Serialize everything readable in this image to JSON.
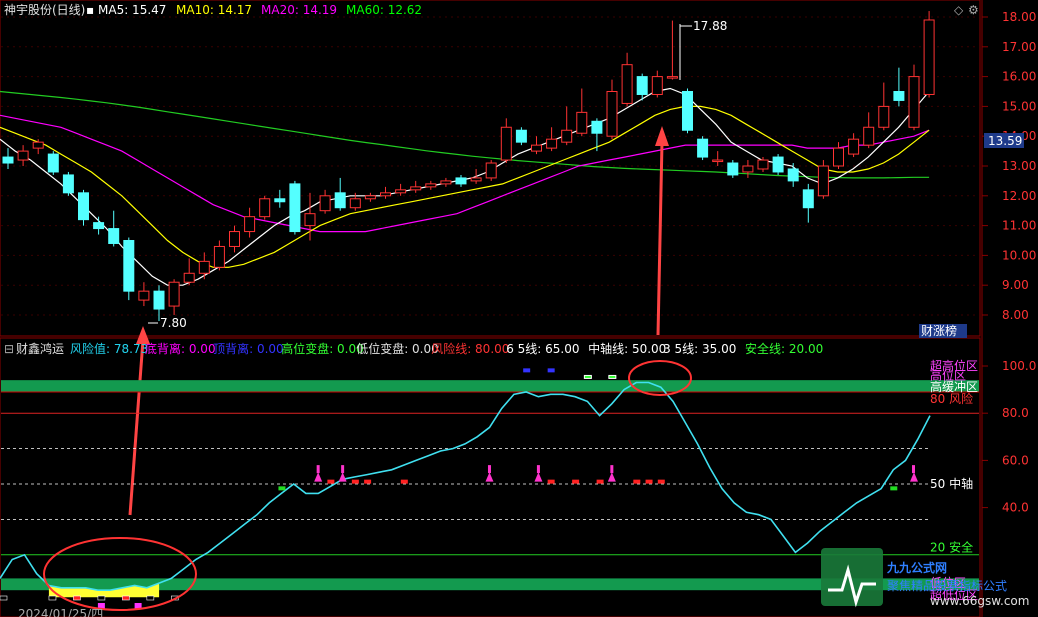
{
  "main_panel": {
    "title": "神宇股份(日线)",
    "ma_labels": [
      {
        "text": "MA5: 15.47",
        "color": "#ffffff"
      },
      {
        "text": "MA10: 14.17",
        "color": "#ffff00"
      },
      {
        "text": "MA20: 14.19",
        "color": "#ff00ff"
      },
      {
        "text": "MA60: 12.62",
        "color": "#00ff00"
      }
    ],
    "price_axis": [
      "18.00",
      "17.00",
      "16.00",
      "15.00",
      "14.00",
      "13.00",
      "12.00",
      "11.00",
      "10.00",
      "9.00",
      "8.00"
    ],
    "price_min": 7.5,
    "price_max": 18.2,
    "current_price": "13.59",
    "current_price_value": 13.59,
    "high_label": "17.88",
    "low_label": "7.80",
    "rank_button": "财涨榜",
    "candles": [
      [
        13.3,
        13.1,
        13.6,
        12.9
      ],
      [
        13.2,
        13.5,
        13.7,
        13.0
      ],
      [
        13.6,
        13.8,
        13.9,
        13.4
      ],
      [
        13.4,
        12.8,
        13.5,
        12.7
      ],
      [
        12.7,
        12.1,
        12.8,
        12.0
      ],
      [
        12.1,
        11.2,
        12.2,
        11.0
      ],
      [
        11.1,
        10.9,
        11.3,
        10.7
      ],
      [
        10.9,
        10.4,
        11.5,
        10.3
      ],
      [
        10.5,
        8.8,
        10.6,
        8.5
      ],
      [
        8.5,
        8.8,
        9.1,
        8.3
      ],
      [
        8.8,
        8.2,
        9.0,
        7.8
      ],
      [
        8.3,
        9.1,
        9.2,
        8.0
      ],
      [
        9.1,
        9.4,
        9.9,
        9.0
      ],
      [
        9.4,
        9.8,
        10.1,
        9.2
      ],
      [
        9.6,
        10.3,
        10.5,
        9.5
      ],
      [
        10.3,
        10.8,
        11.0,
        10.1
      ],
      [
        10.8,
        11.3,
        11.6,
        10.6
      ],
      [
        11.3,
        11.9,
        12.0,
        11.2
      ],
      [
        11.9,
        11.8,
        12.2,
        11.6
      ],
      [
        12.4,
        10.8,
        12.5,
        10.7
      ],
      [
        11.0,
        11.4,
        12.1,
        10.5
      ],
      [
        11.5,
        12.0,
        12.2,
        11.4
      ],
      [
        12.1,
        11.6,
        12.6,
        11.5
      ],
      [
        11.6,
        11.9,
        12.1,
        11.5
      ],
      [
        11.9,
        12.0,
        12.1,
        11.8
      ],
      [
        12.0,
        12.1,
        12.3,
        11.9
      ],
      [
        12.1,
        12.2,
        12.4,
        12.0
      ],
      [
        12.2,
        12.3,
        12.5,
        12.1
      ],
      [
        12.3,
        12.4,
        12.5,
        12.2
      ],
      [
        12.4,
        12.5,
        12.6,
        12.3
      ],
      [
        12.6,
        12.4,
        12.7,
        12.3
      ],
      [
        12.5,
        12.6,
        12.9,
        12.4
      ],
      [
        12.6,
        13.1,
        13.2,
        12.5
      ],
      [
        13.2,
        14.3,
        14.6,
        13.1
      ],
      [
        14.2,
        13.8,
        14.3,
        13.7
      ],
      [
        13.5,
        13.7,
        14.0,
        13.4
      ],
      [
        13.6,
        13.9,
        14.3,
        13.5
      ],
      [
        13.8,
        14.2,
        15.0,
        13.7
      ],
      [
        14.1,
        14.8,
        15.6,
        14.0
      ],
      [
        14.5,
        14.1,
        14.6,
        13.5
      ],
      [
        14.0,
        15.5,
        15.9,
        13.9
      ],
      [
        15.1,
        16.4,
        16.8,
        15.0
      ],
      [
        16.0,
        15.4,
        16.1,
        15.2
      ],
      [
        15.4,
        16.0,
        16.2,
        15.3
      ],
      [
        16.0,
        16.0,
        17.88,
        15.9
      ],
      [
        15.5,
        14.2,
        15.6,
        14.1
      ],
      [
        13.9,
        13.3,
        14.0,
        13.2
      ],
      [
        13.2,
        13.2,
        13.5,
        13.0
      ],
      [
        13.1,
        12.7,
        13.2,
        12.6
      ],
      [
        12.8,
        13.0,
        13.2,
        12.6
      ],
      [
        12.9,
        13.2,
        13.3,
        12.8
      ],
      [
        13.3,
        12.8,
        13.4,
        12.7
      ],
      [
        12.9,
        12.5,
        13.1,
        12.3
      ],
      [
        12.2,
        11.6,
        12.4,
        11.1
      ],
      [
        12.0,
        13.0,
        13.2,
        11.9
      ],
      [
        13.0,
        13.6,
        13.8,
        12.9
      ],
      [
        13.4,
        13.9,
        14.1,
        13.3
      ],
      [
        13.7,
        14.3,
        14.8,
        13.6
      ],
      [
        14.3,
        15.0,
        15.8,
        14.2
      ],
      [
        15.5,
        15.2,
        16.3,
        15.0
      ],
      [
        14.3,
        16.0,
        16.4,
        14.2
      ],
      [
        15.4,
        17.9,
        18.2,
        15.3
      ]
    ],
    "ma5": [
      13.9,
      13.5,
      13.2,
      12.8,
      12.4,
      11.9,
      11.4,
      10.9,
      10.3,
      9.8,
      9.3,
      9.0,
      9.0,
      9.2,
      9.5,
      9.8,
      10.2,
      10.6,
      11.0,
      11.3,
      11.5,
      11.8,
      11.9,
      12.0,
      12.0,
      12.0,
      12.1,
      12.2,
      12.3,
      12.4,
      12.5,
      12.6,
      12.8,
      13.1,
      13.4,
      13.6,
      13.8,
      14.0,
      14.2,
      14.4,
      14.6,
      14.9,
      15.2,
      15.5,
      15.6,
      15.4,
      14.9,
      14.4,
      13.8,
      13.5,
      13.2,
      13.1,
      13.0,
      12.6,
      12.4,
      12.6,
      12.9,
      13.3,
      13.8,
      14.3,
      14.9,
      15.5
    ],
    "ma10": [
      14.3,
      14.1,
      13.9,
      13.7,
      13.4,
      13.1,
      12.8,
      12.4,
      12.0,
      11.5,
      11.0,
      10.5,
      10.1,
      9.8,
      9.6,
      9.6,
      9.7,
      9.9,
      10.1,
      10.4,
      10.7,
      11.0,
      11.2,
      11.4,
      11.5,
      11.6,
      11.7,
      11.8,
      11.9,
      12.0,
      12.1,
      12.2,
      12.3,
      12.4,
      12.6,
      12.8,
      13.0,
      13.2,
      13.4,
      13.6,
      13.8,
      14.1,
      14.4,
      14.7,
      14.9,
      15.0,
      15.0,
      14.9,
      14.7,
      14.4,
      14.1,
      13.8,
      13.5,
      13.2,
      12.9,
      12.8,
      12.8,
      12.9,
      13.1,
      13.4,
      13.8,
      14.2
    ],
    "ma20": [
      14.7,
      14.6,
      14.5,
      14.4,
      14.3,
      14.1,
      13.9,
      13.7,
      13.5,
      13.2,
      12.9,
      12.6,
      12.3,
      12.0,
      11.7,
      11.5,
      11.3,
      11.2,
      11.1,
      11.0,
      10.9,
      10.8,
      10.8,
      10.8,
      10.8,
      10.9,
      11.0,
      11.1,
      11.2,
      11.3,
      11.4,
      11.6,
      11.8,
      12.0,
      12.2,
      12.4,
      12.6,
      12.8,
      13.0,
      13.1,
      13.2,
      13.3,
      13.4,
      13.5,
      13.6,
      13.7,
      13.7,
      13.7,
      13.7,
      13.7,
      13.7,
      13.7,
      13.7,
      13.6,
      13.6,
      13.6,
      13.7,
      13.7,
      13.8,
      13.9,
      14.0,
      14.2
    ],
    "ma60": [
      15.5,
      15.45,
      15.4,
      15.35,
      15.3,
      15.24,
      15.18,
      15.12,
      15.05,
      14.98,
      14.9,
      14.82,
      14.74,
      14.66,
      14.58,
      14.5,
      14.42,
      14.34,
      14.26,
      14.18,
      14.1,
      14.02,
      13.94,
      13.86,
      13.79,
      13.72,
      13.65,
      13.58,
      13.51,
      13.45,
      13.39,
      13.33,
      13.28,
      13.23,
      13.18,
      13.14,
      13.1,
      13.06,
      13.02,
      12.98,
      12.95,
      12.92,
      12.9,
      12.88,
      12.86,
      12.84,
      12.82,
      12.8,
      12.77,
      12.74,
      12.71,
      12.68,
      12.66,
      12.64,
      12.62,
      12.61,
      12.6,
      12.6,
      12.6,
      12.61,
      12.62,
      12.62
    ]
  },
  "indicator_panel": {
    "title": "财鑫鸿运",
    "labels": [
      {
        "text": "风险值: 78.73",
        "color": "#22d3ee"
      },
      {
        "text": "底背离: 0.00",
        "color": "#ff00ff"
      },
      {
        "text": "顶背离: 0.00",
        "color": "#3333ff"
      },
      {
        "text": "高位变盘: 0.00",
        "color": "#33ff33"
      },
      {
        "text": "低位变盘: 0.00",
        "color": "#e0e0e0"
      },
      {
        "text": "风险线: 80.00",
        "color": "#ff3333"
      },
      {
        "text": "6 5线: 65.00",
        "color": "#ffffff"
      },
      {
        "text": "中轴线: 50.00",
        "color": "#ffffff"
      },
      {
        "text": "3 5线: 35.00",
        "color": "#ffffff"
      },
      {
        "text": "安全线: 20.00",
        "color": "#33ff33"
      }
    ],
    "axis": [
      "100.0",
      "80.0",
      "60.0",
      "40.0"
    ],
    "zone_labels": [
      {
        "text": "超高位区",
        "color": "#ff44ff",
        "v": 100
      },
      {
        "text": "高位区",
        "color": "#ff44ff",
        "v": 96
      },
      {
        "text": "高缓冲区",
        "color": "#ffffff",
        "v": 91
      },
      {
        "text": "80 风险",
        "color": "#ff3333",
        "v": 86
      },
      {
        "text": "50 中轴",
        "color": "#ffffff",
        "v": 50
      },
      {
        "text": "20 安全",
        "color": "#33ff33",
        "v": 23
      },
      {
        "text": "低位区",
        "color": "#ff44ff",
        "v": 8
      },
      {
        "text": "超低位区",
        "color": "#ff44ff",
        "v": 3
      }
    ],
    "risk": [
      10,
      18,
      20,
      12,
      7,
      6,
      6,
      6,
      5,
      5,
      6,
      7,
      6,
      8,
      10,
      14,
      18,
      21,
      25,
      29,
      33,
      37,
      42,
      46,
      50,
      46,
      46,
      49,
      52,
      53,
      54,
      55,
      56,
      58,
      60,
      62,
      64,
      65,
      67,
      70,
      74,
      82,
      88,
      89,
      87,
      88,
      88,
      87,
      85,
      79,
      84,
      90,
      93,
      93,
      91,
      85,
      76,
      67,
      57,
      48,
      42,
      38,
      37,
      35,
      28,
      21,
      25,
      30,
      34,
      38,
      42,
      45,
      48,
      56,
      60,
      69,
      79
    ],
    "volume_date_label": "2024/01/25/四"
  },
  "watermark": {
    "brand": "九九公式网",
    "sub": "聚焦精品股票指标公式",
    "url": "www.66gsw.com"
  }
}
